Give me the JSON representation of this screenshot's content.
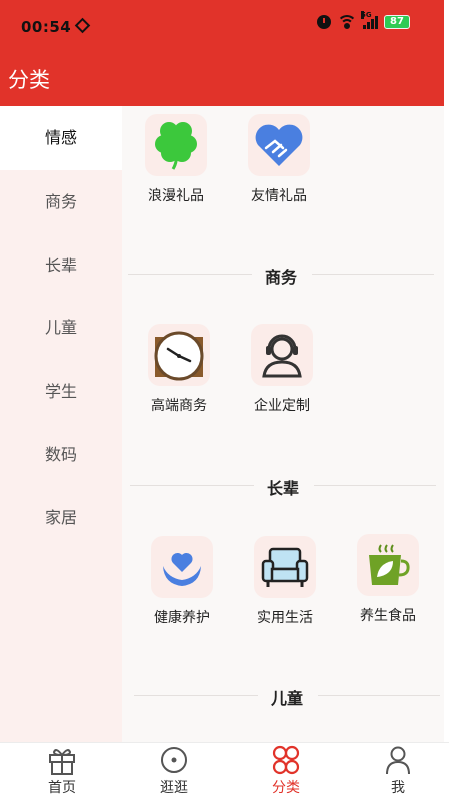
{
  "status_bar": {
    "time": "00:54",
    "battery": "87"
  },
  "header": {
    "title": "分类"
  },
  "sidebar": {
    "items": [
      {
        "label": "情感",
        "active": true
      },
      {
        "label": "商务",
        "active": false
      },
      {
        "label": "长辈",
        "active": false
      },
      {
        "label": "儿童",
        "active": false
      },
      {
        "label": "学生",
        "active": false
      },
      {
        "label": "数码",
        "active": false
      },
      {
        "label": "家居",
        "active": false
      }
    ]
  },
  "content": {
    "group_emotion": {
      "items": [
        {
          "label": "浪漫礼品",
          "icon": "clover-icon"
        },
        {
          "label": "友情礼品",
          "icon": "handshake-heart-icon"
        }
      ]
    },
    "group_business": {
      "title": "商务",
      "items": [
        {
          "label": "高端商务",
          "icon": "wall-clock-icon"
        },
        {
          "label": "企业定制",
          "icon": "headset-person-icon"
        }
      ]
    },
    "group_elder": {
      "title": "长辈",
      "items": [
        {
          "label": "健康养护",
          "icon": "heart-hands-icon"
        },
        {
          "label": "实用生活",
          "icon": "armchair-icon"
        },
        {
          "label": "养生食品",
          "icon": "leaf-tea-cup-icon"
        }
      ]
    },
    "group_children": {
      "title": "儿童"
    }
  },
  "tabbar": {
    "tabs": [
      {
        "label": "首页",
        "icon": "gift-icon",
        "active": false
      },
      {
        "label": "逛逛",
        "icon": "compass-icon",
        "active": false
      },
      {
        "label": "分类",
        "icon": "category-icon",
        "active": true
      },
      {
        "label": "我",
        "icon": "person-icon",
        "active": false
      }
    ]
  },
  "colors": {
    "accent": "#e1332a",
    "sidebar_bg": "#fcf0ee",
    "tile_bg": "#fbece9",
    "content_bg": "#faf8f7"
  }
}
